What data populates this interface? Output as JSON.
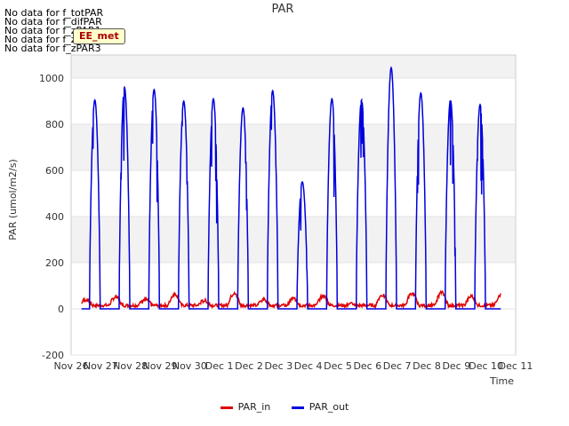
{
  "nodata": [
    "No data for f_totPAR",
    "No data for f_difPAR",
    "No data for f_zPAR1",
    "No data for f_zPAR2",
    "No data for f_zPAR3"
  ],
  "badge": "EE_met",
  "chart_data": {
    "type": "line",
    "title": "PAR",
    "xlabel": "Time",
    "ylabel": "PAR (umol/m2/s)",
    "ylim": [
      -200,
      1100
    ],
    "yticks": [
      -200,
      0,
      200,
      400,
      600,
      800,
      1000
    ],
    "xlim": [
      0,
      15
    ],
    "xticks": [
      "Nov 26",
      "Nov 27",
      "Nov 28",
      "Nov 29",
      "Nov 30",
      "Dec 1",
      "Dec 2",
      "Dec 3",
      "Dec 4",
      "Dec 5",
      "Dec 6",
      "Dec 7",
      "Dec 8",
      "Dec 9",
      "Dec 10",
      "Dec 11"
    ],
    "grid": "alternating horizontal bands",
    "legend": "bottom-center",
    "series": [
      {
        "name": "PAR_in",
        "color": "#dd0000",
        "daily_peaks": [
          40,
          50,
          40,
          65,
          35,
          65,
          40,
          45,
          55,
          20,
          60,
          65,
          70,
          55,
          60,
          55
        ]
      },
      {
        "name": "PAR_out",
        "color": "#0000dd",
        "daily_peaks": [
          905,
          960,
          950,
          900,
          910,
          870,
          945,
          550,
          910,
          905,
          1045,
          935,
          905,
          885
        ]
      }
    ]
  }
}
